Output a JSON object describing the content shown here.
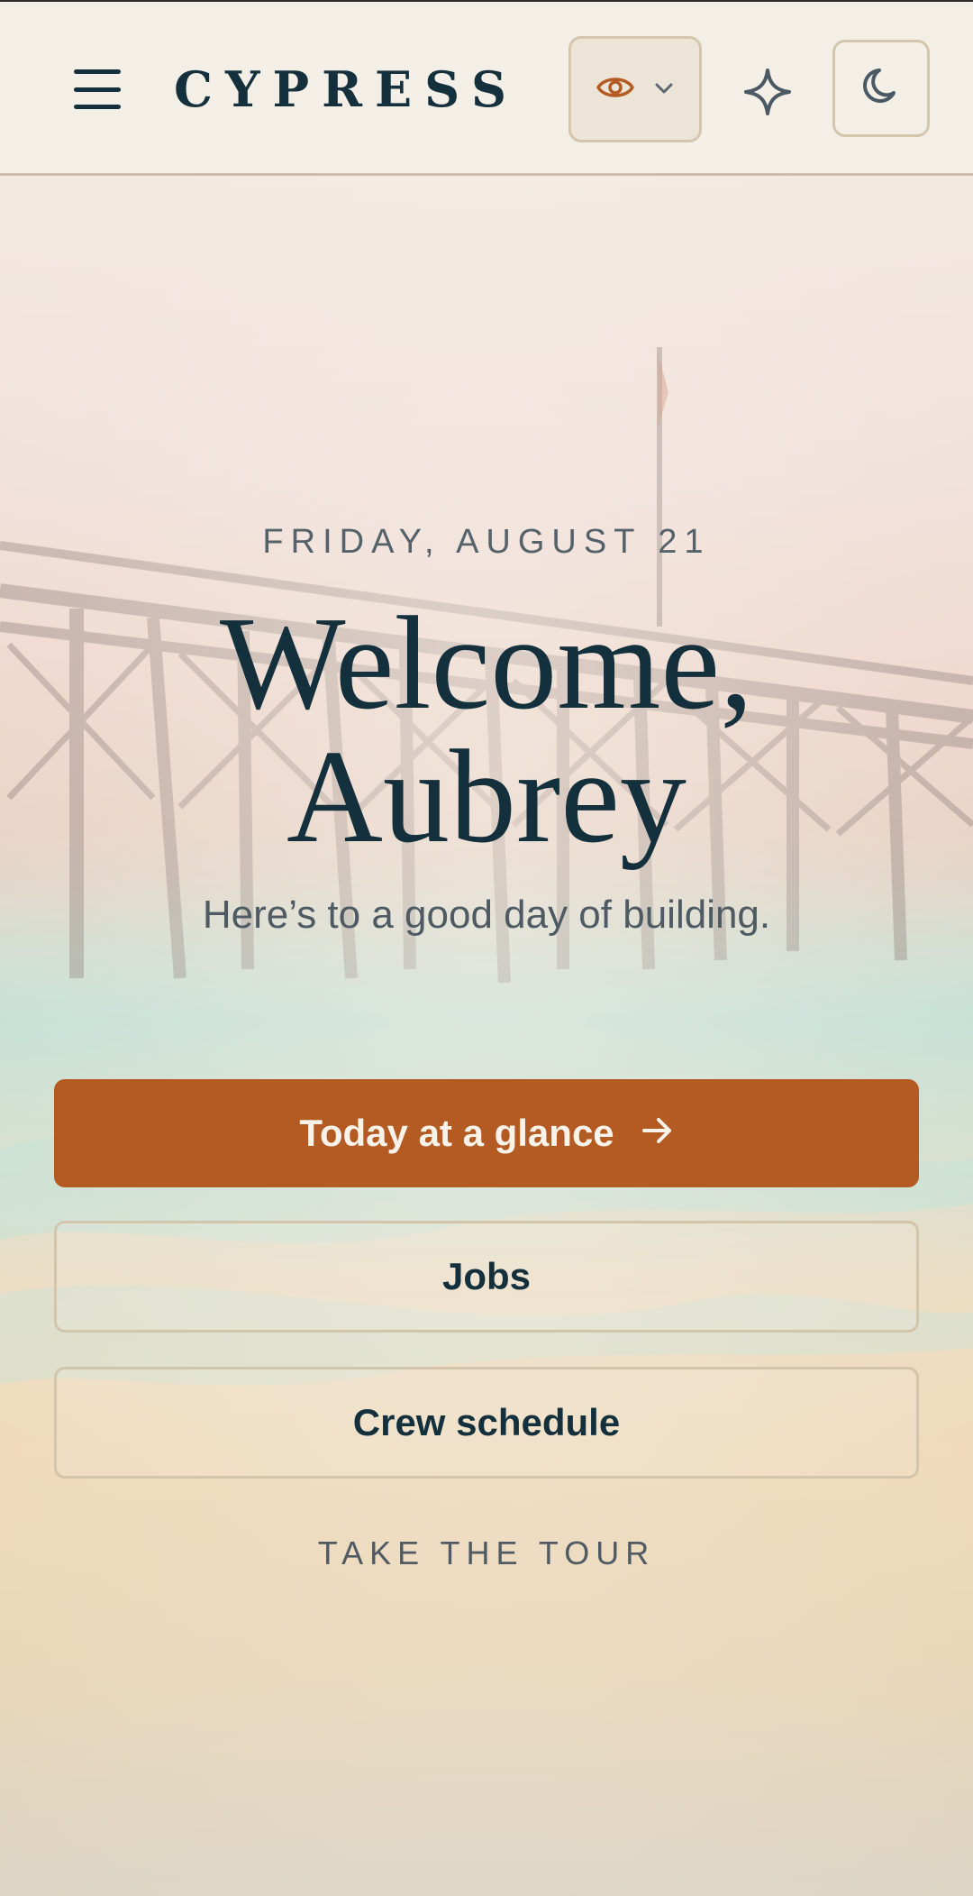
{
  "header": {
    "brand": "CYPRESS",
    "menu_icon": "hamburger-menu-icon",
    "view_icon": "eye-icon",
    "view_chevron_icon": "chevron-down-icon",
    "assistant_icon": "sparkle-icon",
    "theme_icon": "moon-icon"
  },
  "hero": {
    "date": "FRIDAY, AUGUST 21",
    "welcome_line1": "Welcome,",
    "welcome_line2": "Aubrey",
    "tagline": "Here’s to a good day of building.",
    "background": "beach-pier-photo"
  },
  "actions": {
    "primary_label": "Today at a glance",
    "primary_icon": "arrow-right-icon",
    "jobs_label": "Jobs",
    "crew_label": "Crew schedule",
    "tour_label": "TAKE THE TOUR"
  },
  "colors": {
    "accent": "#b45a23",
    "ink": "#14303d",
    "header_bg": "#f4efe6",
    "border": "#d3c5ab"
  }
}
